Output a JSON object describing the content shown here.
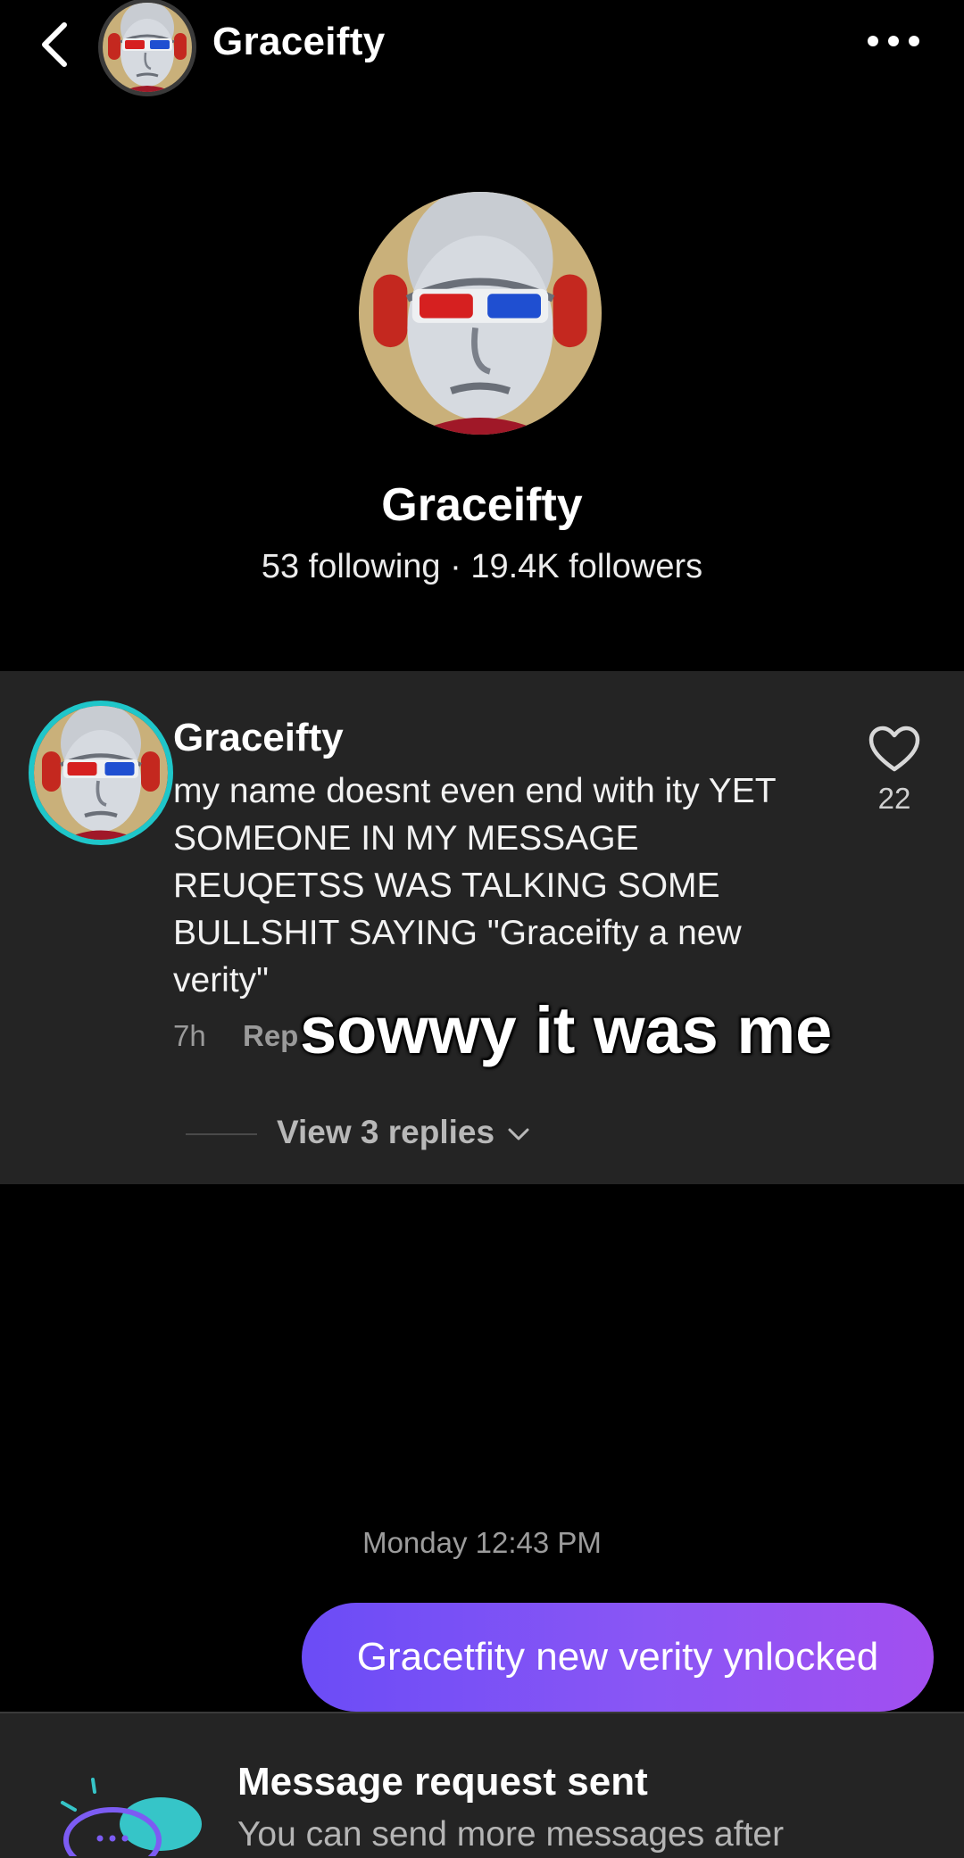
{
  "header": {
    "title": "Graceifty",
    "back_icon": "chevron-left-icon",
    "more_icon": "more-horizontal-icon"
  },
  "profile": {
    "name": "Graceifty",
    "stats": "53 following · 19.4K followers"
  },
  "comment": {
    "username": "Graceifty",
    "text": "my name doesnt even end with ity YET SOMEONE IN MY MESSAGE REUQETSS WAS TALKING SOME BULLSHIT SAYING \"Graceifty a new verity\"",
    "time": "7h",
    "reply_label": "Rep",
    "likes": "22",
    "view_replies": "View 3 replies",
    "ring_color": "#1fc6c9"
  },
  "overlay_caption": "sowwy it was me",
  "chat": {
    "timestamp": "Monday 12:43 PM",
    "message": "Gracetfity new verity ynlocked",
    "bubble_colors": [
      "#6b4cf6",
      "#a24ff0"
    ]
  },
  "request": {
    "title": "Message request sent",
    "subtitle": "You can send more messages after",
    "icon": "chat-bubbles-icon"
  }
}
